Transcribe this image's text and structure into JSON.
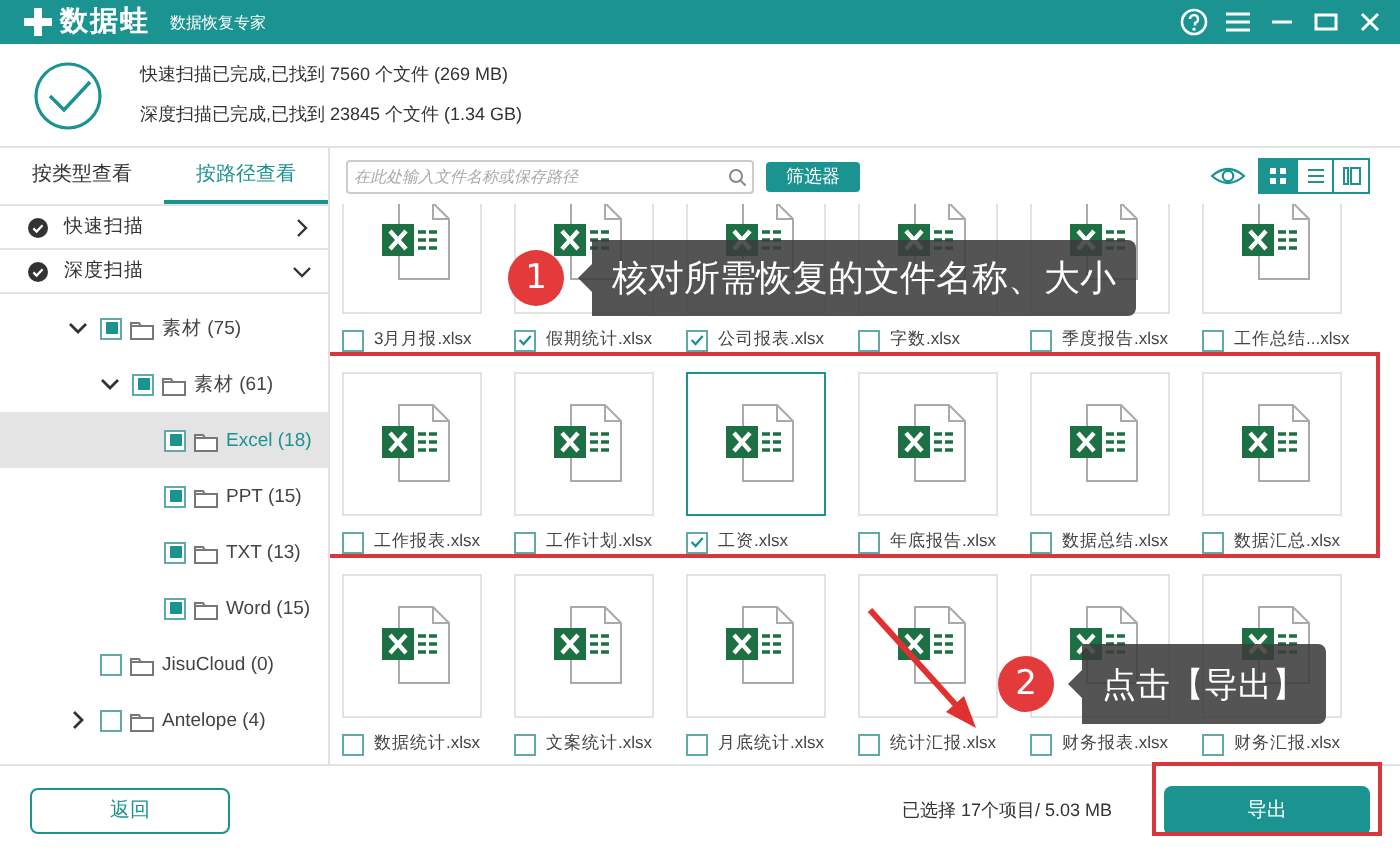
{
  "window": {
    "logo": "数据蛙",
    "subtitle": "数据恢复专家"
  },
  "scan_summary": [
    "快速扫描已完成,已找到 7560 个文件 (269 MB)",
    "深度扫描已完成,已找到 23845 个文件 (1.34 GB)"
  ],
  "view_tabs": [
    {
      "label": "按类型查看",
      "selected": false
    },
    {
      "label": "按路径查看",
      "selected": true
    }
  ],
  "sidebar": {
    "sections": [
      {
        "label": "快速扫描",
        "expanded": false
      },
      {
        "label": "深度扫描",
        "expanded": true
      }
    ],
    "tree": [
      {
        "label": "素材 (75)",
        "checked": true,
        "selected": false,
        "expanded": true,
        "children": [
          {
            "label": "素材 (61)",
            "checked": true,
            "selected": false,
            "expanded": true,
            "children": [
              {
                "label": "Excel (18)",
                "checked": true,
                "selected": true
              },
              {
                "label": "PPT (15)",
                "checked": true,
                "selected": false
              },
              {
                "label": "TXT (13)",
                "checked": true,
                "selected": false
              },
              {
                "label": "Word (15)",
                "checked": true,
                "selected": false
              }
            ]
          }
        ]
      },
      {
        "label": "JisuCloud (0)",
        "checked": false,
        "selected": false
      },
      {
        "label": "Antelope (4)",
        "checked": false,
        "selected": false,
        "expanded": false
      }
    ]
  },
  "search": {
    "placeholder": "在此处输入文件名称或保存路径"
  },
  "filter_button": "筛选器",
  "view_modes": [
    {
      "kind": "grid",
      "selected": true
    },
    {
      "kind": "list",
      "selected": false
    },
    {
      "kind": "detail",
      "selected": false
    }
  ],
  "file_rows": [
    {
      "items": [
        {
          "name": "3月月报.xlsx",
          "checked": false,
          "selected": false
        },
        {
          "name": "假期统计.xlsx",
          "checked": true,
          "selected": false
        },
        {
          "name": "公司报表.xlsx",
          "checked": true,
          "selected": false
        },
        {
          "name": "字数.xlsx",
          "checked": false,
          "selected": false
        },
        {
          "name": "季度报告.xlsx",
          "checked": false,
          "selected": false
        },
        {
          "name": "工作总结...xlsx",
          "checked": false,
          "selected": false
        }
      ]
    },
    {
      "items": [
        {
          "name": "工作报表.xlsx",
          "checked": false,
          "selected": false
        },
        {
          "name": "工作计划.xlsx",
          "checked": false,
          "selected": false
        },
        {
          "name": "工资.xlsx",
          "checked": true,
          "selected": true
        },
        {
          "name": "年底报告.xlsx",
          "checked": false,
          "selected": false
        },
        {
          "name": "数据总结.xlsx",
          "checked": false,
          "selected": false
        },
        {
          "name": "数据汇总.xlsx",
          "checked": false,
          "selected": false
        }
      ]
    },
    {
      "items": [
        {
          "name": "数据统计.xlsx",
          "checked": false,
          "selected": false
        },
        {
          "name": "文案统计.xlsx",
          "checked": false,
          "selected": false
        },
        {
          "name": "月底统计.xlsx",
          "checked": false,
          "selected": false
        },
        {
          "name": "统计汇报.xlsx",
          "checked": false,
          "selected": false
        },
        {
          "name": "财务报表.xlsx",
          "checked": false,
          "selected": false
        },
        {
          "name": "财务汇报.xlsx",
          "checked": false,
          "selected": false
        }
      ]
    }
  ],
  "footer": {
    "back_button": "返回",
    "status": "已选择 17个项目/ 5.03 MB",
    "export_button": "导出"
  },
  "annotations": [
    {
      "number": "1",
      "text": "核对所需恢复的文件名称、大小"
    },
    {
      "number": "2",
      "text": "点击【导出】"
    }
  ]
}
